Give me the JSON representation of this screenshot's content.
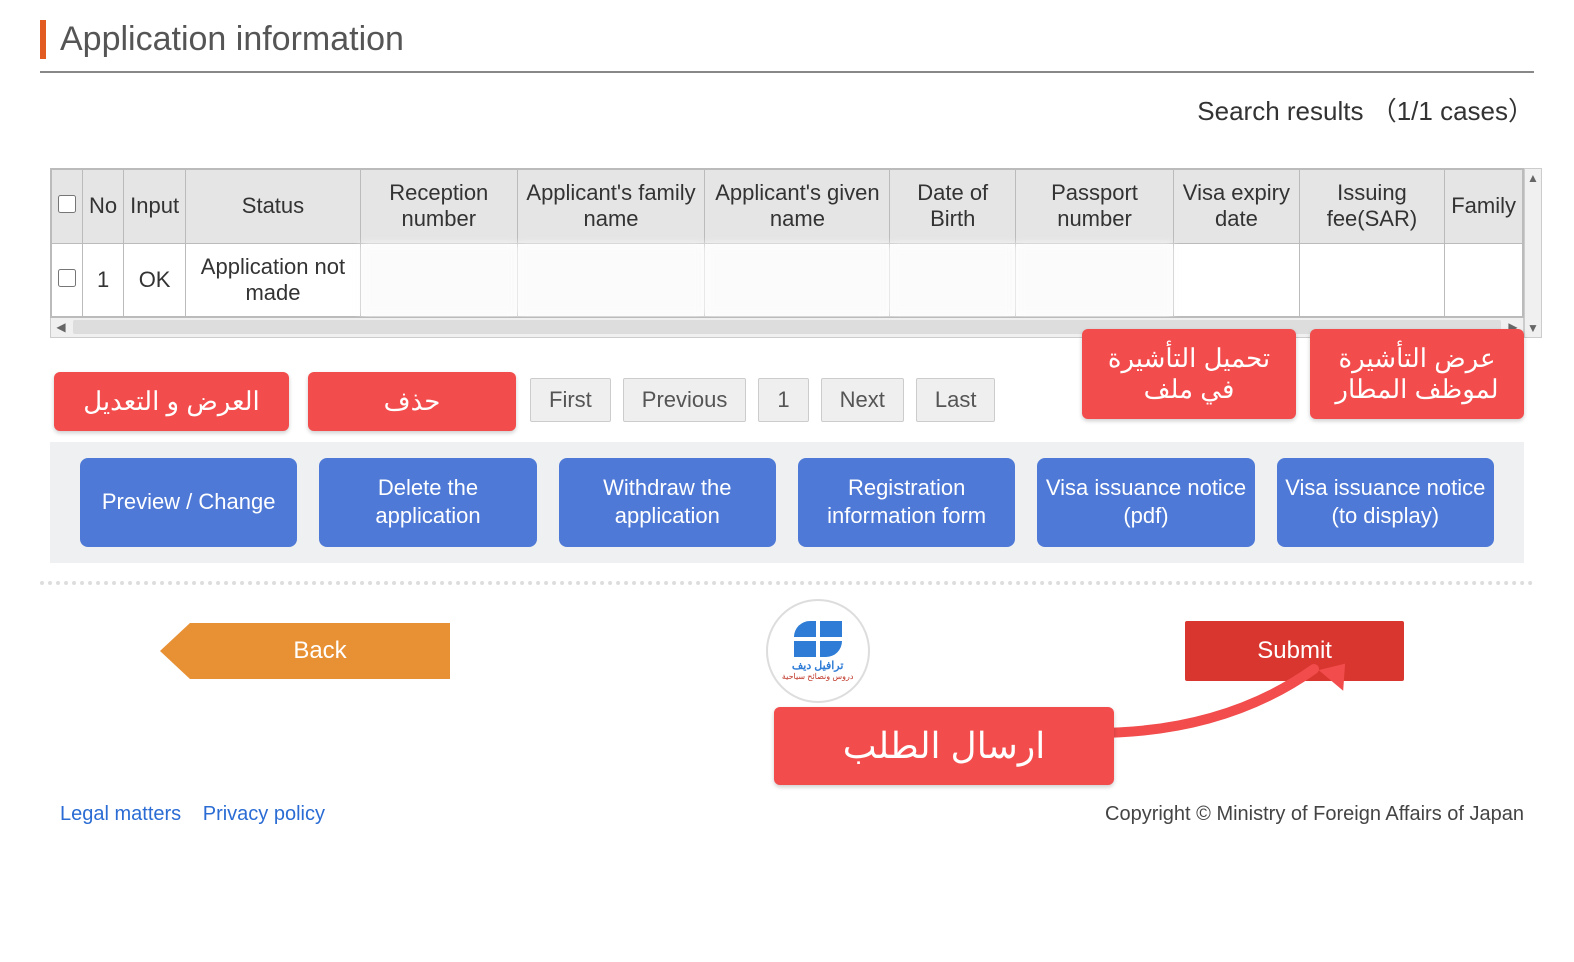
{
  "page": {
    "title": "Application information",
    "search_results": "Search results （1/1 cases）"
  },
  "table": {
    "headers": {
      "no": "No",
      "input": "Input",
      "status": "Status",
      "reception": "Reception number",
      "family": "Applicant's family name",
      "given": "Applicant's given name",
      "dob": "Date of Birth",
      "passport": "Passport number",
      "visa_expiry": "Visa expiry date",
      "fee": "Issuing fee(SAR)",
      "family_col": "Family"
    },
    "row": {
      "no": "1",
      "input": "OK",
      "status": "Application not made"
    }
  },
  "annotations": {
    "preview": "العرض و التعديل",
    "delete": "حذف",
    "download": "تحميل التأشيرة في ملف",
    "display": "عرض التأشيرة لموظف المطار",
    "submit": "ارسال الطلب"
  },
  "pagination": {
    "first": "First",
    "previous": "Previous",
    "page": "1",
    "next": "Next",
    "last": "Last"
  },
  "actions": {
    "preview": "Preview / Change",
    "delete": "Delete the application",
    "withdraw": "Withdraw the application",
    "reginfo": "Registration information form",
    "notice_pdf": "Visa issuance notice (pdf)",
    "notice_display": "Visa issuance notice (to display)"
  },
  "nav": {
    "back": "Back",
    "submit": "Submit"
  },
  "logo": {
    "name": "ترافيل ديف",
    "tagline": "دروس ونصائح سياحية"
  },
  "footer": {
    "legal": "Legal matters",
    "privacy": "Privacy policy",
    "copyright": "Copyright © Ministry of Foreign Affairs of Japan"
  }
}
